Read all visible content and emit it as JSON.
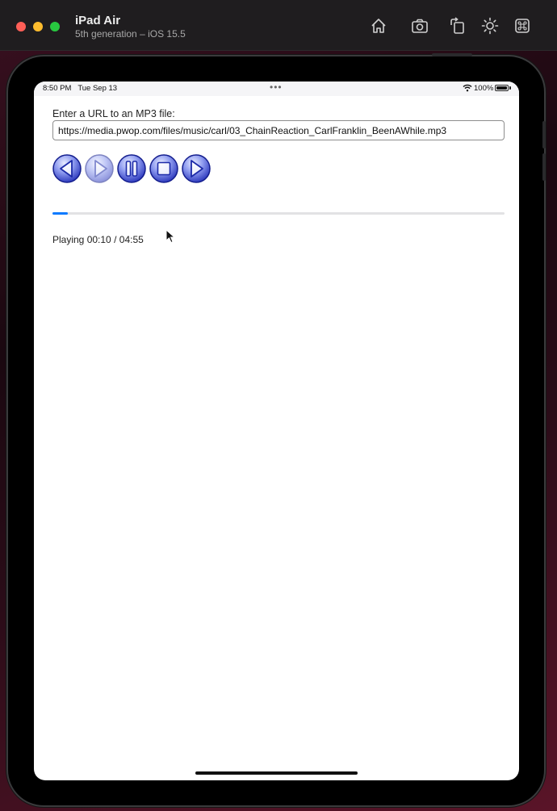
{
  "simulator": {
    "device_name": "iPad Air",
    "device_subtitle": "5th generation – iOS 15.5",
    "toolbar": [
      "home-icon",
      "screenshot-icon",
      "rotate-icon",
      "appearance-icon",
      "shortcut-icon"
    ]
  },
  "statusbar": {
    "time": "8:50 PM",
    "date": "Tue Sep 13",
    "multitask_dots": "•••",
    "battery": "100%"
  },
  "form": {
    "url_label": "Enter a URL to an MP3 file:",
    "url_value": "https://media.pwop.com/files/music/carl/03_ChainReaction_CarlFranklin_BeenAWhile.mp3"
  },
  "controls": [
    {
      "name": "rewind-button",
      "icon": "rewind-icon",
      "enabled": true
    },
    {
      "name": "play-button",
      "icon": "play-icon",
      "enabled": false
    },
    {
      "name": "pause-button",
      "icon": "pause-icon",
      "enabled": true
    },
    {
      "name": "stop-button",
      "icon": "stop-icon",
      "enabled": true
    },
    {
      "name": "forward-button",
      "icon": "forward-icon",
      "enabled": true
    }
  ],
  "player": {
    "progress_fraction": 0.034,
    "status_state": "Playing",
    "position": "00:10",
    "separator": "/",
    "duration": "04:55"
  },
  "colors": {
    "accent": "#0a7aff",
    "button_dark": "#1a2aa8",
    "button_light": "#9aa6f0"
  }
}
